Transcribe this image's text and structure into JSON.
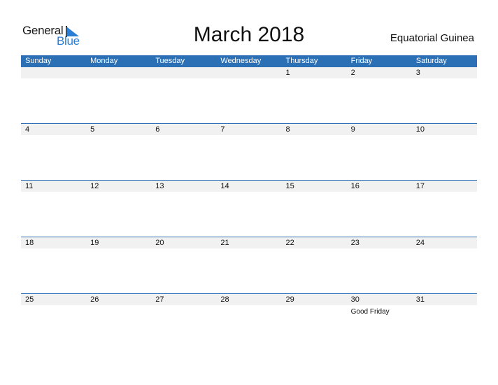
{
  "logo": {
    "line1": "General",
    "line2": "Blue"
  },
  "title": "March 2018",
  "country": "Equatorial Guinea",
  "colors": {
    "header_bg": "#2b6fb5",
    "band_bg": "#f1f1f1",
    "logo_blue": "#2a7fd4"
  },
  "weekdays": [
    "Sunday",
    "Monday",
    "Tuesday",
    "Wednesday",
    "Thursday",
    "Friday",
    "Saturday"
  ],
  "weeks": [
    {
      "days": [
        "",
        "",
        "",
        "",
        "1",
        "2",
        "3"
      ],
      "holidays": [
        "",
        "",
        "",
        "",
        "",
        "",
        ""
      ]
    },
    {
      "days": [
        "4",
        "5",
        "6",
        "7",
        "8",
        "9",
        "10"
      ],
      "holidays": [
        "",
        "",
        "",
        "",
        "",
        "",
        ""
      ]
    },
    {
      "days": [
        "11",
        "12",
        "13",
        "14",
        "15",
        "16",
        "17"
      ],
      "holidays": [
        "",
        "",
        "",
        "",
        "",
        "",
        ""
      ]
    },
    {
      "days": [
        "18",
        "19",
        "20",
        "21",
        "22",
        "23",
        "24"
      ],
      "holidays": [
        "",
        "",
        "",
        "",
        "",
        "",
        ""
      ]
    },
    {
      "days": [
        "25",
        "26",
        "27",
        "28",
        "29",
        "30",
        "31"
      ],
      "holidays": [
        "",
        "",
        "",
        "",
        "",
        "Good Friday",
        ""
      ]
    }
  ]
}
